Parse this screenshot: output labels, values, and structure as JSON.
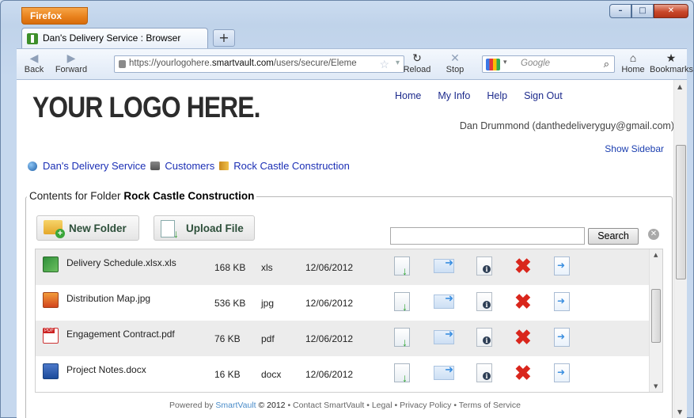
{
  "browser": {
    "menu_button": "Firefox",
    "tab_title": "Dan's Delivery Service : Browser",
    "new_tab": "+",
    "back": "Back",
    "forward": "Forward",
    "url_prefix": "https://yourlogohere.",
    "url_domain": "smartvault.com",
    "url_rest": "/users/secure/Eleme",
    "reload": "Reload",
    "stop": "Stop",
    "search_placeholder": "Google",
    "home": "Home",
    "bookmarks": "Bookmarks"
  },
  "page": {
    "logo": "YOUR LOGO HERE.",
    "nav": [
      "Home",
      "My Info",
      "Help",
      "Sign Out"
    ],
    "user": "Dan Drummond (danthedeliveryguy@gmail.com)",
    "show_sidebar": "Show Sidebar",
    "breadcrumb": [
      "Dan's Delivery Service",
      "Customers",
      "Rock Castle Construction"
    ],
    "legend_prefix": "Contents for Folder",
    "legend_folder": "Rock Castle Construction",
    "new_folder": "New Folder",
    "upload_file": "Upload File",
    "search_value": "",
    "search_button": "Search",
    "files": [
      {
        "name": "Delivery Schedule.xlsx.xls",
        "size": "168 KB",
        "type": "xls",
        "date": "12/06/2012",
        "icon": "excel-file-icon"
      },
      {
        "name": "Distribution Map.jpg",
        "size": "536 KB",
        "type": "jpg",
        "date": "12/06/2012",
        "icon": "image-file-icon"
      },
      {
        "name": "Engagement Contract.pdf",
        "size": "76 KB",
        "type": "pdf",
        "date": "12/06/2012",
        "icon": "pdf-file-icon"
      },
      {
        "name": "Project Notes.docx",
        "size": "16 KB",
        "type": "docx",
        "date": "12/06/2012",
        "icon": "word-file-icon"
      }
    ],
    "footer": {
      "powered": "Powered by",
      "brand": "SmartVault",
      "copyright": "© 2012",
      "links": [
        "Contact SmartVault",
        "Legal",
        "Privacy Policy",
        "Terms of Service"
      ],
      "separator": "•"
    }
  },
  "colors": {
    "link": "#1b2fb5",
    "accent_orange": "#e9821d",
    "delete_red": "#d9261c"
  }
}
